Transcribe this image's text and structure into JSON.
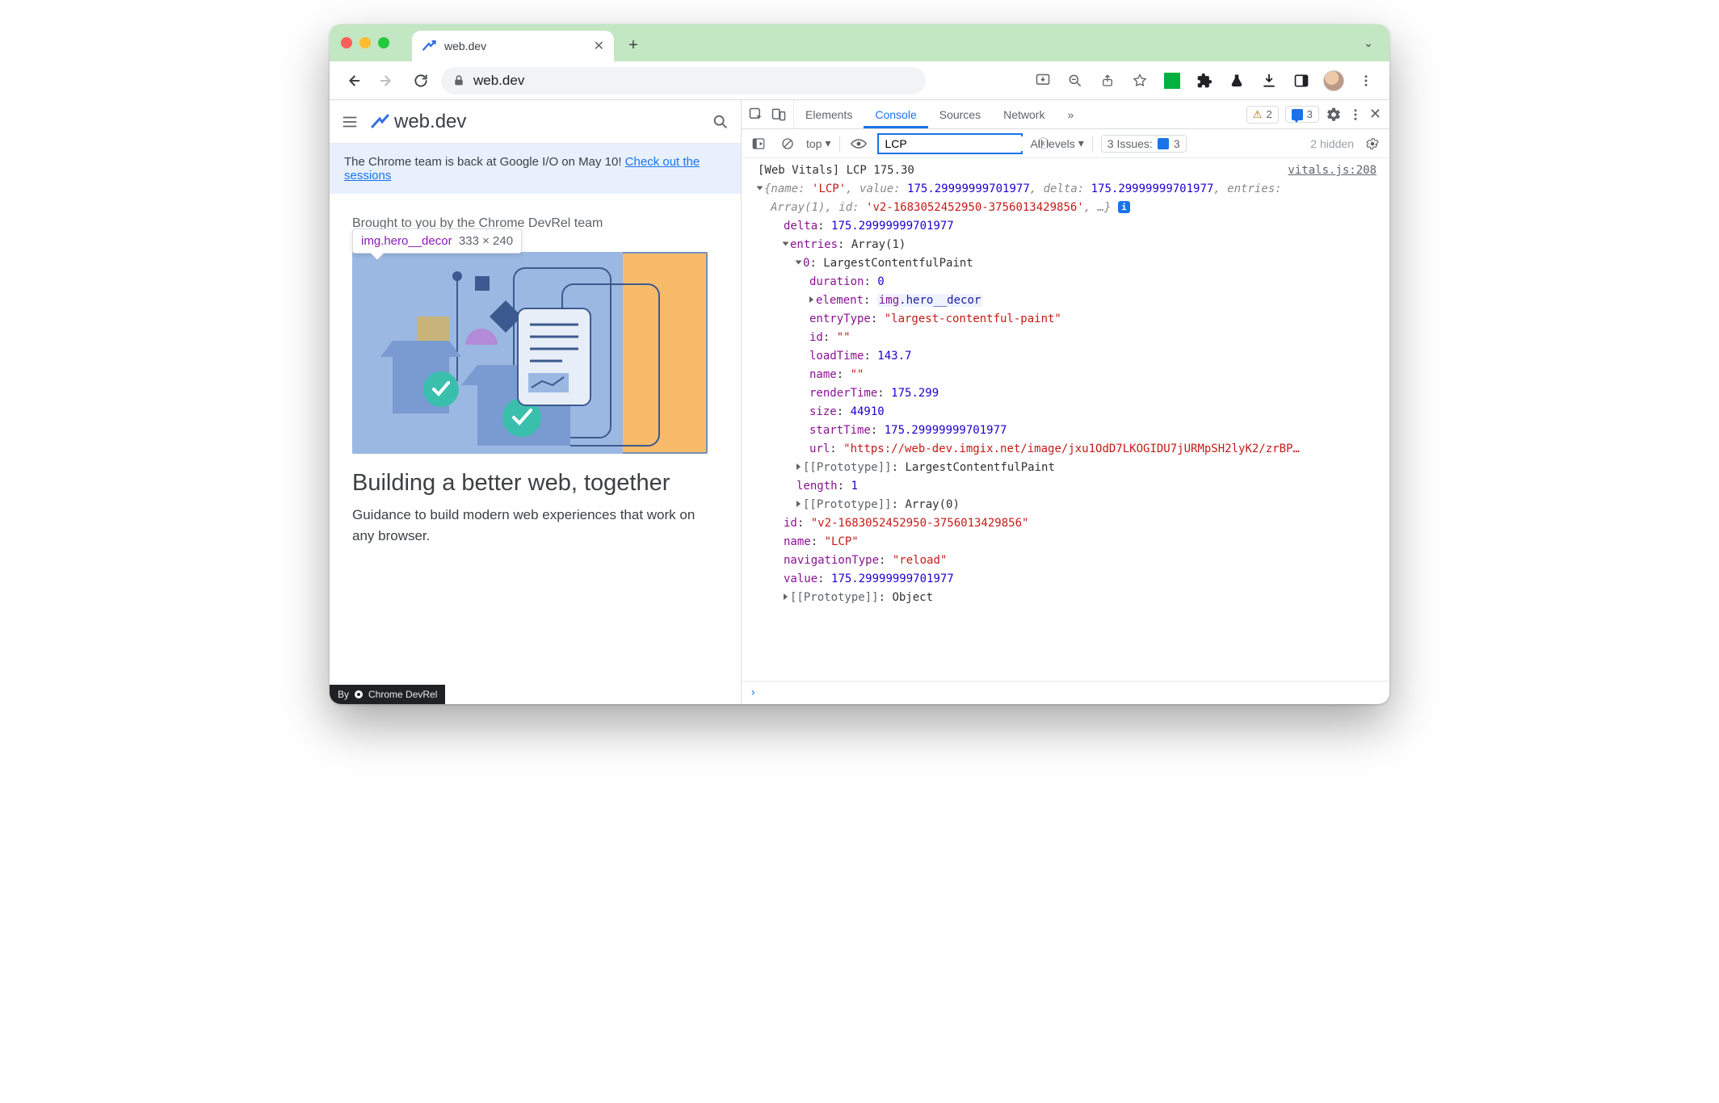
{
  "browser": {
    "tab_title": "web.dev",
    "url_display": "web.dev",
    "new_tab_glyph": "+",
    "chevron_glyph": "⌄"
  },
  "page": {
    "site_name": "web.dev",
    "banner_text": "The Chrome team is back at Google I/O on May 10! ",
    "banner_link": "Check out the sessions",
    "brought": "Brought to you by the Chrome DevRel team",
    "tooltip_selector": "img.hero__decor",
    "tooltip_dims": "333 × 240",
    "headline": "Building a better web, together",
    "blurb": "Guidance to build modern web experiences that work on any browser.",
    "badge_prefix": "By",
    "badge_name": "Chrome DevRel"
  },
  "devtools": {
    "tabs": {
      "elements": "Elements",
      "console": "Console",
      "sources": "Sources",
      "network": "Network",
      "more": "»"
    },
    "counts": {
      "warn": "2",
      "msg": "3"
    },
    "filter": {
      "context": "top",
      "input_value": "LCP",
      "levels": "All levels",
      "issues_label": "3 Issues:",
      "issues_count": "3",
      "hidden": "2 hidden"
    },
    "log": {
      "source_link": "vitals.js:208",
      "header": "[Web Vitals] LCP 175.30",
      "summary_name": "'LCP'",
      "summary_value": "175.29999999701977",
      "summary_delta": "175.29999999701977",
      "summary_entries": "Array(1)",
      "summary_id": "'v2-1683052452950-3756013429856'",
      "delta": "175.29999999701977",
      "entries_label": "Array(1)",
      "entry0_type": "LargestContentfulPaint",
      "duration": "0",
      "element": "img.hero__decor",
      "entryType": "\"largest-contentful-paint\"",
      "id_empty": "\"\"",
      "loadTime": "143.7",
      "name_empty": "\"\"",
      "renderTime": "175.299",
      "size": "44910",
      "startTime": "175.29999999701977",
      "url": "\"https://web-dev.imgix.net/image/jxu1OdD7LKOGIDU7jURMpSH2lyK2/zrBP…",
      "proto_entry": "LargestContentfulPaint",
      "length": "1",
      "proto_arr": "Array(0)",
      "obj_id": "\"v2-1683052452950-3756013429856\"",
      "obj_name": "\"LCP\"",
      "navType": "\"reload\"",
      "obj_value": "175.29999999701977",
      "proto_obj": "Object"
    }
  }
}
